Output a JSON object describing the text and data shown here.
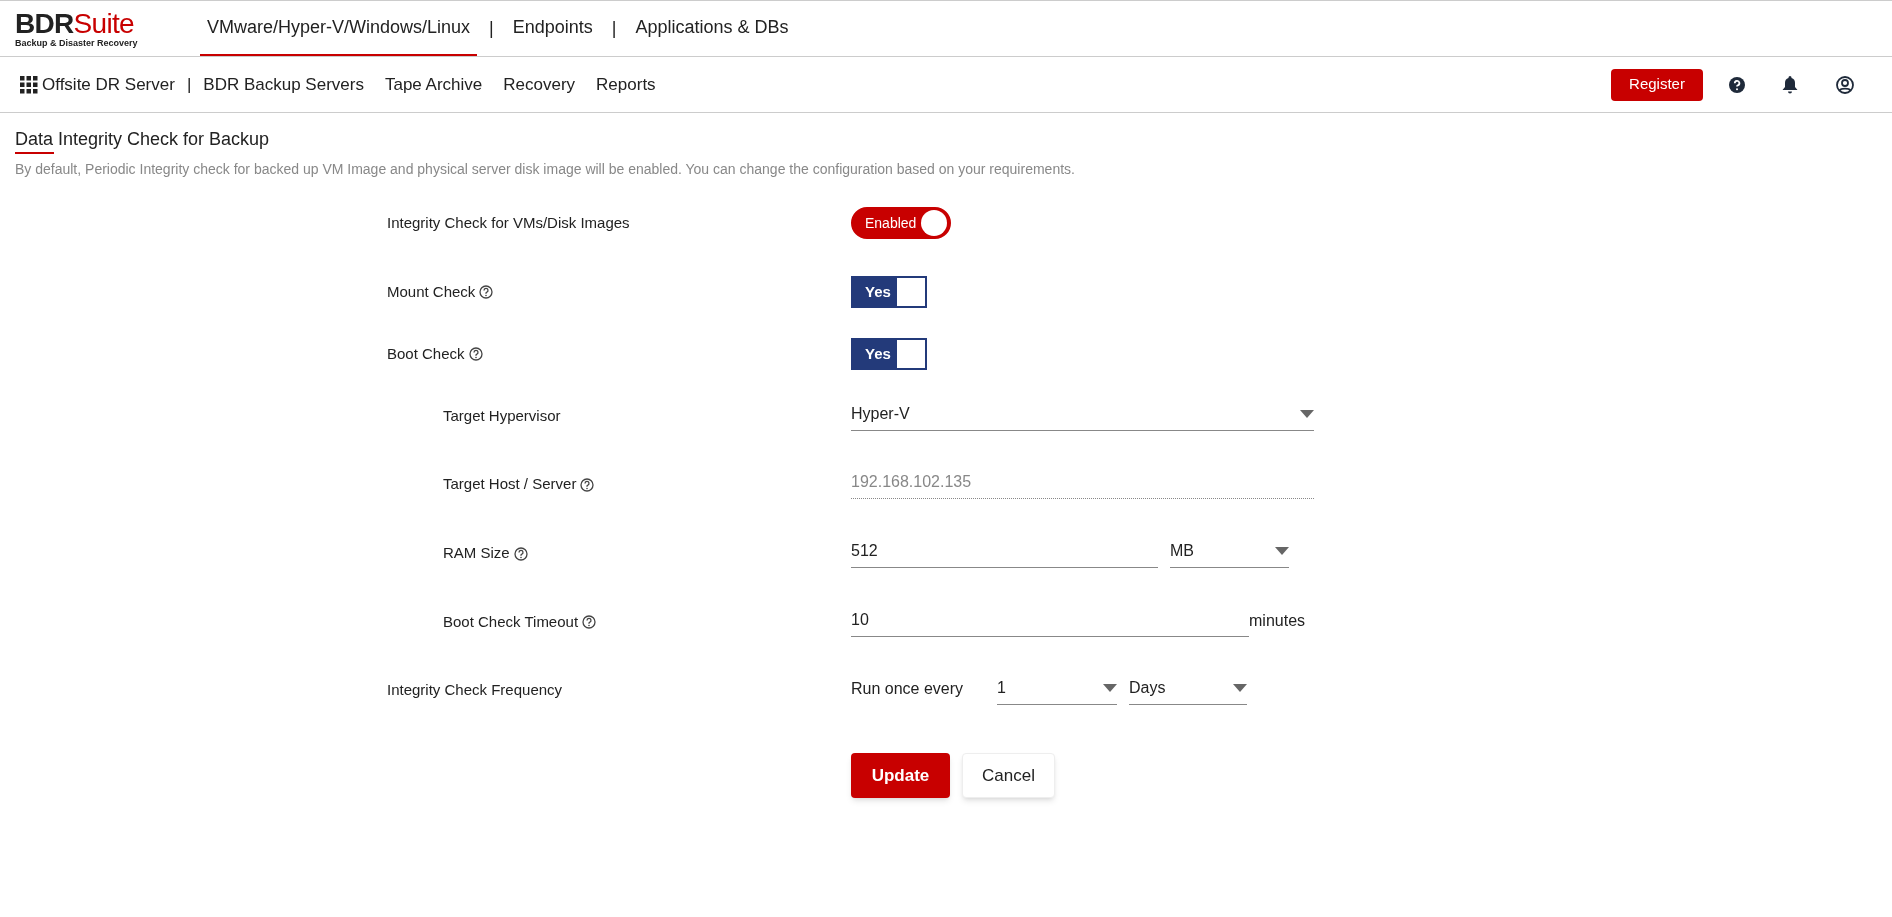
{
  "header": {
    "logo": {
      "brand": "BDR",
      "brand_accent": "Suite",
      "tagline": "Backup & Disaster Recovery"
    },
    "separator": "|",
    "tabs": [
      {
        "label": "VMware/Hyper-V/Windows/Linux",
        "selected": true
      },
      {
        "label": "Endpoints",
        "selected": false
      },
      {
        "label": "Applications & DBs",
        "selected": false
      }
    ]
  },
  "nav": {
    "home": "Offsite DR Server",
    "separator": "|",
    "items": [
      {
        "label": "BDR Backup Servers"
      },
      {
        "label": "Tape Archive"
      },
      {
        "label": "Recovery"
      },
      {
        "label": "Reports"
      }
    ],
    "register": "Register"
  },
  "page": {
    "title": "Data Integrity Check for Backup",
    "description": "By default, Periodic Integrity check for backed up VM Image and physical server disk image will be enabled. You can change the configuration based on your requirements."
  },
  "form": [
    {
      "kind": "pill",
      "label": "Integrity Check for VMs/Disk Images",
      "help": false,
      "indented": false,
      "on": true,
      "text": "Enabled"
    },
    {
      "kind": "yes",
      "label": "Mount Check",
      "help": true,
      "indented": false,
      "on": true,
      "text": "Yes"
    },
    {
      "kind": "yes",
      "label": "Boot Check",
      "help": true,
      "indented": false,
      "on": true,
      "text": "Yes"
    },
    {
      "kind": "select",
      "label": "Target Hypervisor",
      "help": false,
      "indented": true,
      "value": "Hyper-V"
    },
    {
      "kind": "readonly",
      "label": "Target Host / Server",
      "help": true,
      "indented": true,
      "disabled": true,
      "value": "192.168.102.135"
    },
    {
      "kind": "unit_select",
      "label": "RAM Size",
      "help": true,
      "indented": true,
      "value": "512",
      "unit": "MB"
    },
    {
      "kind": "unit_text",
      "label": "Boot Check Timeout",
      "help": true,
      "indented": true,
      "value": "10",
      "unit": "minutes"
    },
    {
      "kind": "frequency",
      "label": "Integrity Check Frequency",
      "help": false,
      "indented": false,
      "prefix": "Run once every",
      "value": "1",
      "unit": "Days"
    }
  ],
  "buttons": {
    "primary": "Update",
    "secondary": "Cancel"
  }
}
